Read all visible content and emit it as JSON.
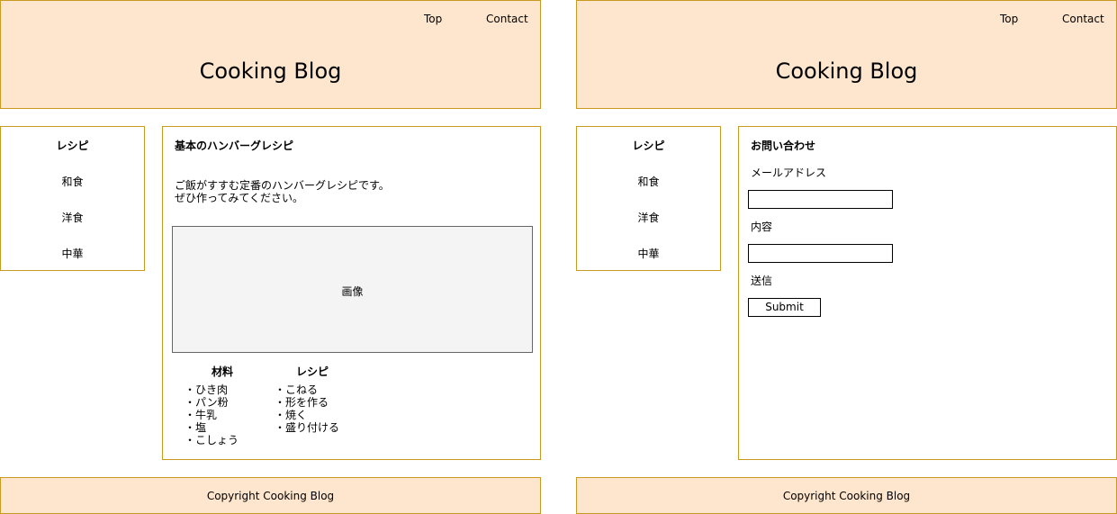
{
  "pages": [
    {
      "header": {
        "title": "Cooking Blog",
        "nav": [
          "Top",
          "Contact"
        ]
      },
      "sidebar": {
        "heading": "レシピ",
        "items": [
          "和食",
          "洋食",
          "中華"
        ]
      },
      "main": {
        "heading": "基本のハンバーグレシピ",
        "intro_lines": [
          "ご飯がすすむ定番のハンバーグレシピです。",
          "ぜひ作ってみてください。"
        ],
        "image_label": "画像",
        "ingredients": {
          "heading": "材料",
          "items": [
            "・ひき肉",
            "・パン粉",
            "・牛乳",
            "・塩",
            "・こしょう"
          ]
        },
        "steps": {
          "heading": "レシピ",
          "items": [
            "・こねる",
            "・形を作る",
            "・焼く",
            "・盛り付ける"
          ]
        }
      },
      "footer": {
        "text": "Copyright Cooking Blog"
      }
    },
    {
      "header": {
        "title": "Cooking Blog",
        "nav": [
          "Top",
          "Contact"
        ]
      },
      "sidebar": {
        "heading": "レシピ",
        "items": [
          "和食",
          "洋食",
          "中華"
        ]
      },
      "main": {
        "heading": "お問い合わせ",
        "email_label": "メールアドレス",
        "content_label": "内容",
        "send_label": "送信",
        "submit_label": "Submit"
      },
      "footer": {
        "text": "Copyright Cooking Blog"
      }
    }
  ],
  "colors": {
    "accent_border": "#c89a22",
    "header_fill": "#fde6cd",
    "image_fill": "#f4f4f4"
  }
}
